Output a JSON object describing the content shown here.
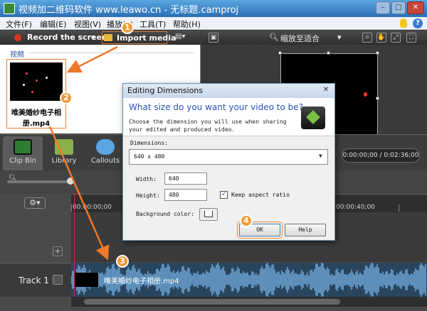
{
  "window": {
    "title": "视频加二维码软件 www.leawo.cn - 无标题.camproj",
    "min_label": "–",
    "max_label": "□",
    "close_label": "✕"
  },
  "menu": [
    "文件(F)",
    "编辑(E)",
    "视图(V)",
    "播放(P)",
    "工具(T)",
    "帮助(H)"
  ],
  "toolbar": {
    "record_label": "Record the screen",
    "import_label": "Import media"
  },
  "clip_bin": {
    "section_label": "视频",
    "clip_name": "唯美婚纱电子相册.mp4"
  },
  "preview": {
    "zoom_label": "缩放至适合"
  },
  "tabs": [
    {
      "label": "Clip Bin",
      "icon": "film-icon"
    },
    {
      "label": "Library",
      "icon": "library-icon"
    },
    {
      "label": "Callouts",
      "icon": "callout-icon"
    }
  ],
  "time_display": "0:00:00;00 / 0:02:36;00",
  "timeline": {
    "ruler_labels": [
      "00:00:00;00",
      "00:00:40;00"
    ],
    "track_label": "Track 1",
    "track_clip_name": "唯美婚纱电子相册.mp4"
  },
  "dialog": {
    "title": "Editing Dimensions",
    "question": "What size do you want your video to be?",
    "subtitle": "Choose the dimension you will use when sharing your edited and produced video.",
    "dimensions_label": "Dimensions:",
    "dimensions_value": "640 x 480",
    "width_label": "Width:",
    "width_value": "640",
    "height_label": "Height:",
    "height_value": "480",
    "keep_aspect_label": "Keep aspect ratio",
    "keep_aspect_checked": true,
    "bg_color_label": "Background color:",
    "ok_label": "OK",
    "help_label": "Help"
  },
  "callouts": [
    "1",
    "2",
    "3",
    "4"
  ],
  "colors": {
    "callout": "#f29a3a",
    "arrow": "#f07828",
    "waveform": "#6fa8d8"
  }
}
